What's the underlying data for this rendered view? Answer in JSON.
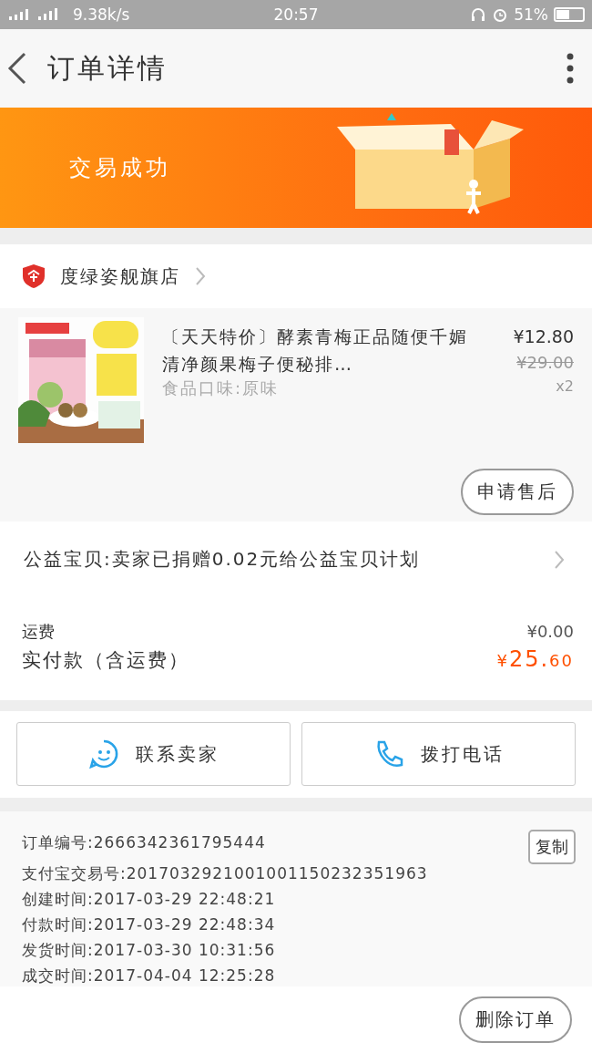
{
  "status_bar": {
    "network": "9.38k/s",
    "time": "20:57",
    "battery": "51%"
  },
  "header": {
    "title": "订单详情"
  },
  "banner": {
    "text": "交易成功"
  },
  "shop": {
    "name": "度绿姿舰旗店"
  },
  "product": {
    "title": "〔天天特价〕酵素青梅正品随便千媚清净颜果梅子便秘排…",
    "spec": "食品口味:原味",
    "price": "¥12.80",
    "original_price": "¥29.00",
    "quantity": "x2",
    "action": "申请售后"
  },
  "donation": {
    "text": "公益宝贝:卖家已捐赠0.02元给公益宝贝计划"
  },
  "costs": [
    {
      "label": "运费",
      "value": "¥0.00",
      "kind": "shipping"
    },
    {
      "label": "实付款（含运费）",
      "value_prefix": "¥",
      "value_main": "25.",
      "value_tail": "60",
      "kind": "total"
    }
  ],
  "contact_buttons": [
    {
      "label": "联系卖家",
      "kind": "chat"
    },
    {
      "label": "拨打电话",
      "kind": "phone"
    }
  ],
  "order_info": {
    "copy_button": "复制",
    "lines": [
      "订单编号:2666342361795444",
      "支付宝交易号:2017032921001001150232351963",
      "创建时间:2017-03-29 22:48:21",
      "付款时间:2017-03-29 22:48:34",
      "发货时间:2017-03-30 10:31:56",
      "成交时间:2017-04-04 12:25:28"
    ]
  },
  "footer": {
    "button": "删除订单"
  }
}
